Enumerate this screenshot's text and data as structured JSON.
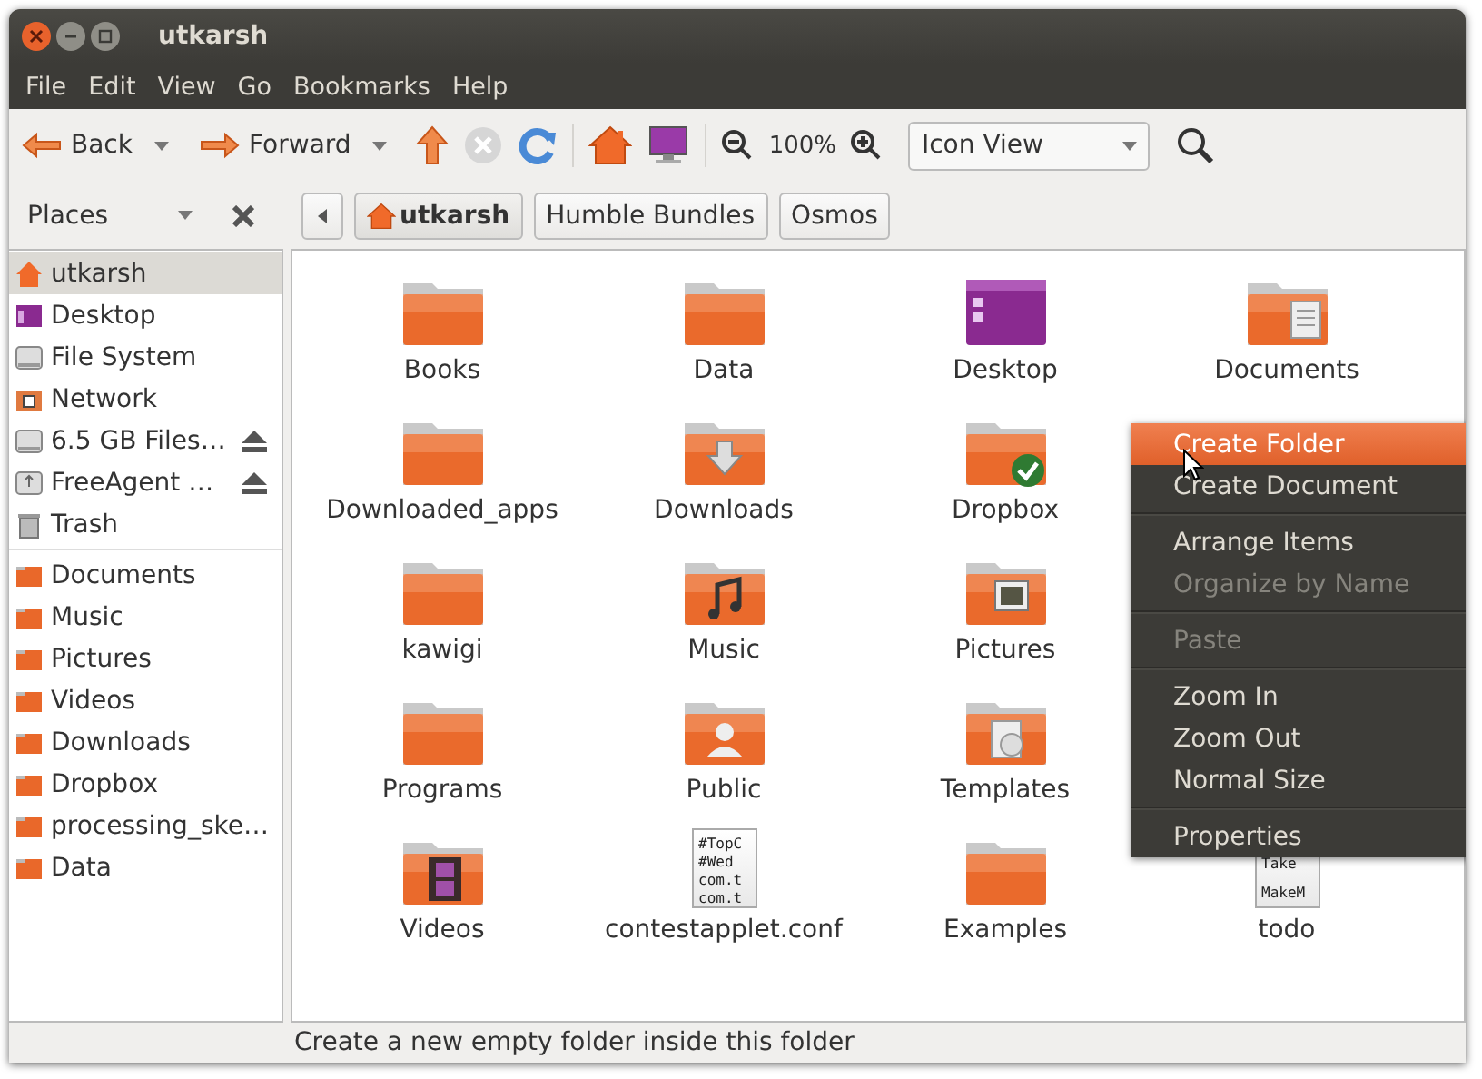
{
  "window": {
    "title": "utkarsh"
  },
  "menu_bar": [
    "File",
    "Edit",
    "View",
    "Go",
    "Bookmarks",
    "Help"
  ],
  "toolbar": {
    "back": "Back",
    "forward": "Forward",
    "zoom": "100%",
    "view_select": "Icon View"
  },
  "places": {
    "label": "Places"
  },
  "path": [
    {
      "label": "utkarsh",
      "home": true,
      "selected": true
    },
    {
      "label": "Humble Bundles",
      "home": false,
      "selected": false
    },
    {
      "label": "Osmos",
      "home": false,
      "selected": false
    }
  ],
  "sidebar": [
    [
      {
        "label": "utkarsh",
        "kind": "home",
        "eject": false,
        "selected": true
      },
      {
        "label": "Desktop",
        "kind": "desktop",
        "eject": false,
        "selected": false
      },
      {
        "label": "File System",
        "kind": "drive",
        "eject": false,
        "selected": false
      },
      {
        "label": "Network",
        "kind": "network",
        "eject": false,
        "selected": false
      },
      {
        "label": "6.5 GB Files…",
        "kind": "drive",
        "eject": true,
        "selected": false
      },
      {
        "label": "FreeAgent …",
        "kind": "usb",
        "eject": true,
        "selected": false
      },
      {
        "label": "Trash",
        "kind": "trash",
        "eject": false,
        "selected": false
      }
    ],
    [
      {
        "label": "Documents",
        "kind": "folder",
        "eject": false,
        "selected": false
      },
      {
        "label": "Music",
        "kind": "folder",
        "eject": false,
        "selected": false
      },
      {
        "label": "Pictures",
        "kind": "folder",
        "eject": false,
        "selected": false
      },
      {
        "label": "Videos",
        "kind": "folder",
        "eject": false,
        "selected": false
      },
      {
        "label": "Downloads",
        "kind": "folder",
        "eject": false,
        "selected": false
      },
      {
        "label": "Dropbox",
        "kind": "folder",
        "eject": false,
        "selected": false
      },
      {
        "label": "processing_ske…",
        "kind": "folder",
        "eject": false,
        "selected": false
      },
      {
        "label": "Data",
        "kind": "folder",
        "eject": false,
        "selected": false
      }
    ]
  ],
  "files": [
    [
      {
        "name": "Books",
        "kind": "folder"
      },
      {
        "name": "Data",
        "kind": "folder"
      },
      {
        "name": "Desktop",
        "kind": "desktop"
      },
      {
        "name": "Documents",
        "kind": "documents"
      }
    ],
    [
      {
        "name": "Downloaded_apps",
        "kind": "folder"
      },
      {
        "name": "Downloads",
        "kind": "downloads"
      },
      {
        "name": "Dropbox",
        "kind": "dropbox"
      }
    ],
    [
      {
        "name": "kawigi",
        "kind": "folder"
      },
      {
        "name": "Music",
        "kind": "music"
      },
      {
        "name": "Pictures",
        "kind": "pictures"
      }
    ],
    [
      {
        "name": "Programs",
        "kind": "folder"
      },
      {
        "name": "Public",
        "kind": "public"
      },
      {
        "name": "Templates",
        "kind": "templates"
      }
    ],
    [
      {
        "name": "Videos",
        "kind": "videos"
      },
      {
        "name": "contestapplet.conf",
        "kind": "text",
        "preview": [
          "#TopC",
          "#Wed",
          "com.t",
          "com.t"
        ]
      },
      {
        "name": "Examples",
        "kind": "folder"
      },
      {
        "name": "todo",
        "kind": "text",
        "preview": [
          "Take",
          "MakeM"
        ]
      }
    ]
  ],
  "context_menu": [
    [
      {
        "label": "Create Folder",
        "selected": true,
        "disabled": false
      },
      {
        "label": "Create Document",
        "selected": false,
        "disabled": false
      }
    ],
    [
      {
        "label": "Arrange Items",
        "selected": false,
        "disabled": false
      },
      {
        "label": "Organize by Name",
        "selected": false,
        "disabled": true
      }
    ],
    [
      {
        "label": "Paste",
        "selected": false,
        "disabled": true
      }
    ],
    [
      {
        "label": "Zoom In",
        "selected": false,
        "disabled": false
      },
      {
        "label": "Zoom Out",
        "selected": false,
        "disabled": false
      },
      {
        "label": "Normal Size",
        "selected": false,
        "disabled": false
      }
    ],
    [
      {
        "label": "Properties",
        "selected": false,
        "disabled": false
      }
    ]
  ],
  "status_bar": "Create a new empty folder inside this folder"
}
